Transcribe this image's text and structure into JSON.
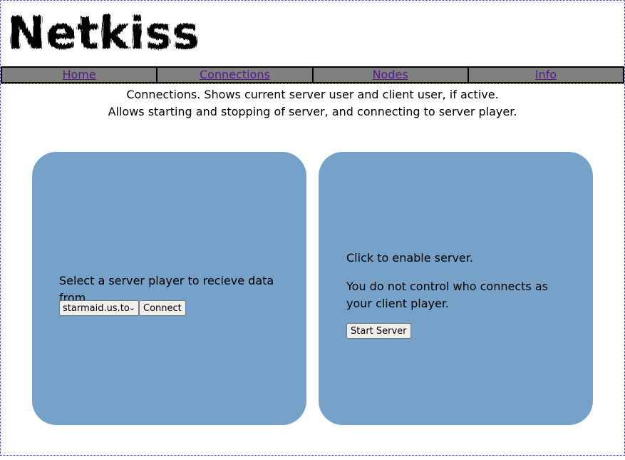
{
  "brand": {
    "logo_text": "Netkiss"
  },
  "nav": {
    "items": [
      {
        "label": "Home"
      },
      {
        "label": "Connections"
      },
      {
        "label": "Nodes"
      },
      {
        "label": "Info"
      }
    ],
    "link_color": "#551a8b",
    "bar_color": "#808080"
  },
  "page": {
    "description": "Connections. Shows current server user and client user, if active. Allows starting and stopping of server, and connecting to server player."
  },
  "client_panel": {
    "prompt": "Select a server player to recieve data from.",
    "server_select": {
      "selected": "starmaid.us.to",
      "chevron": "chevron-down-icon"
    },
    "connect_label": "Connect"
  },
  "server_panel": {
    "enable_text": "Click to enable server.",
    "warning_text": "You do not control who connects as your client player.",
    "start_label": "Start Server"
  },
  "colors": {
    "panel": "#76a2ca",
    "frame_border": "#3a3ab0"
  }
}
